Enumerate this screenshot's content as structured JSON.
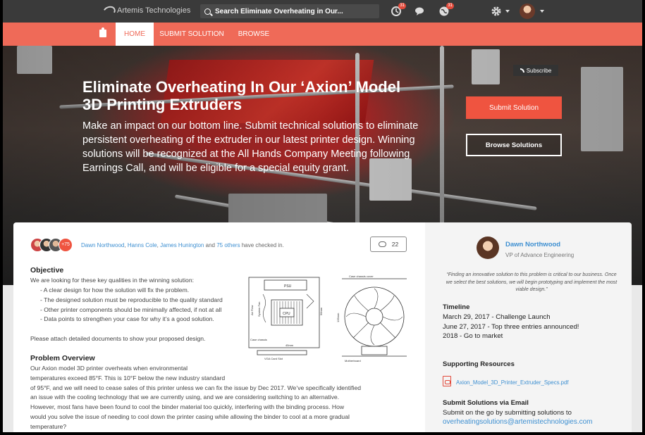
{
  "topbar": {
    "logo_text": "Artemis Technologies",
    "search_text": "Search Eliminate Overheating in Our...",
    "notif_badge_1": "31",
    "notif_badge_2": "31"
  },
  "nav": {
    "home": "HOME",
    "submit": "SUBMIT SOLUTION",
    "browse": "BROWSE"
  },
  "hero": {
    "title": "Eliminate Overheating In Our ‘Axion’ Model 3D Printing Extruders",
    "description": "Make an impact on our bottom line. Submit technical solutions to eliminate persistent overheating of the extruder in our latest printer design. Winning solutions will be recognized at the All Hands Company Meeting following Earnings Call, and will be eligible for a special equity grant.",
    "subscribe": "Subscribe",
    "submit_button": "Submit Solution",
    "browse_button": "Browse Solutions"
  },
  "checkins": {
    "extra_count": "+75",
    "name1": "Dawn Northwood",
    "sep1": ",",
    "name2": "Hanns Cole",
    "sep2": ",",
    "name3": "James Hunington",
    "and": "and",
    "others": "75 others",
    "suffix": "have checked in.",
    "comment_count": "22"
  },
  "objective": {
    "heading": "Objective",
    "intro": "We are looking for these key qualities in the winning solution:",
    "items": [
      "- A clear design for how the solution will fix the problem.",
      "- The designed solution must be reproducible to the quality standard",
      "- Other printer components should be minimally affected, if not at all",
      "- Data points to strengthen your case for why it’s a good solution."
    ],
    "attach": "Please attach detailed documents to show your proposed design."
  },
  "problem": {
    "heading": "Problem Overview",
    "lines": [
      "Our Axion model 3D printer overheats when environmental",
      "temperatures exceed 85°F. This is 10°F below the new industry standard",
      "of 95°F, and we will need to cease sales of this printer unless we can fix the issue by Dec 2017. We’ve specifically identified",
      "an issue with the cooling technology that we are currently using, and we are considering switching to an alternative.",
      "However, most fans have been found to cool the binder material too quickly, interfering with the binding process. How",
      "would you solve the issue of needing to cool down the printer casing while allowing the binder to cool at a more gradual",
      "temperature?"
    ]
  },
  "diagram": {
    "psu": "PSU",
    "cpu": "CPU",
    "air_flow": "Air Flow",
    "system_fan": "System Fan",
    "case_chassis": "Case chassis",
    "vga": "VGA Card Slot",
    "dim_45": "45mm",
    "dim_96": "96mm",
    "case_cover": "Case chassis cover",
    "dim_135": "135mm",
    "motherboard": "Motherboard"
  },
  "sidebar": {
    "name": "Dawn Northwood",
    "role": "VP of Advance Engineering",
    "quote": "“Finding an innovative solution to this problem is critical to our business. Once we select the best solutions, we will begin prototyping and implement the most viable design.”",
    "timeline_heading": "Timeline",
    "timeline": [
      "March 29, 2017 - Challenge Launch",
      "June 27, 2017 - Top three entries announced!",
      "2018 - Go to market"
    ],
    "resources_heading": "Supporting Resources",
    "resource_file": "Axion_Model_3D_Printer_Extruder_Specs.pdf",
    "email_heading": "Submit Solutions via Email",
    "email_text": "Submit on the go by submitting solutions to",
    "email_address": "overheatingsolutions@artemistechnologies.com"
  }
}
